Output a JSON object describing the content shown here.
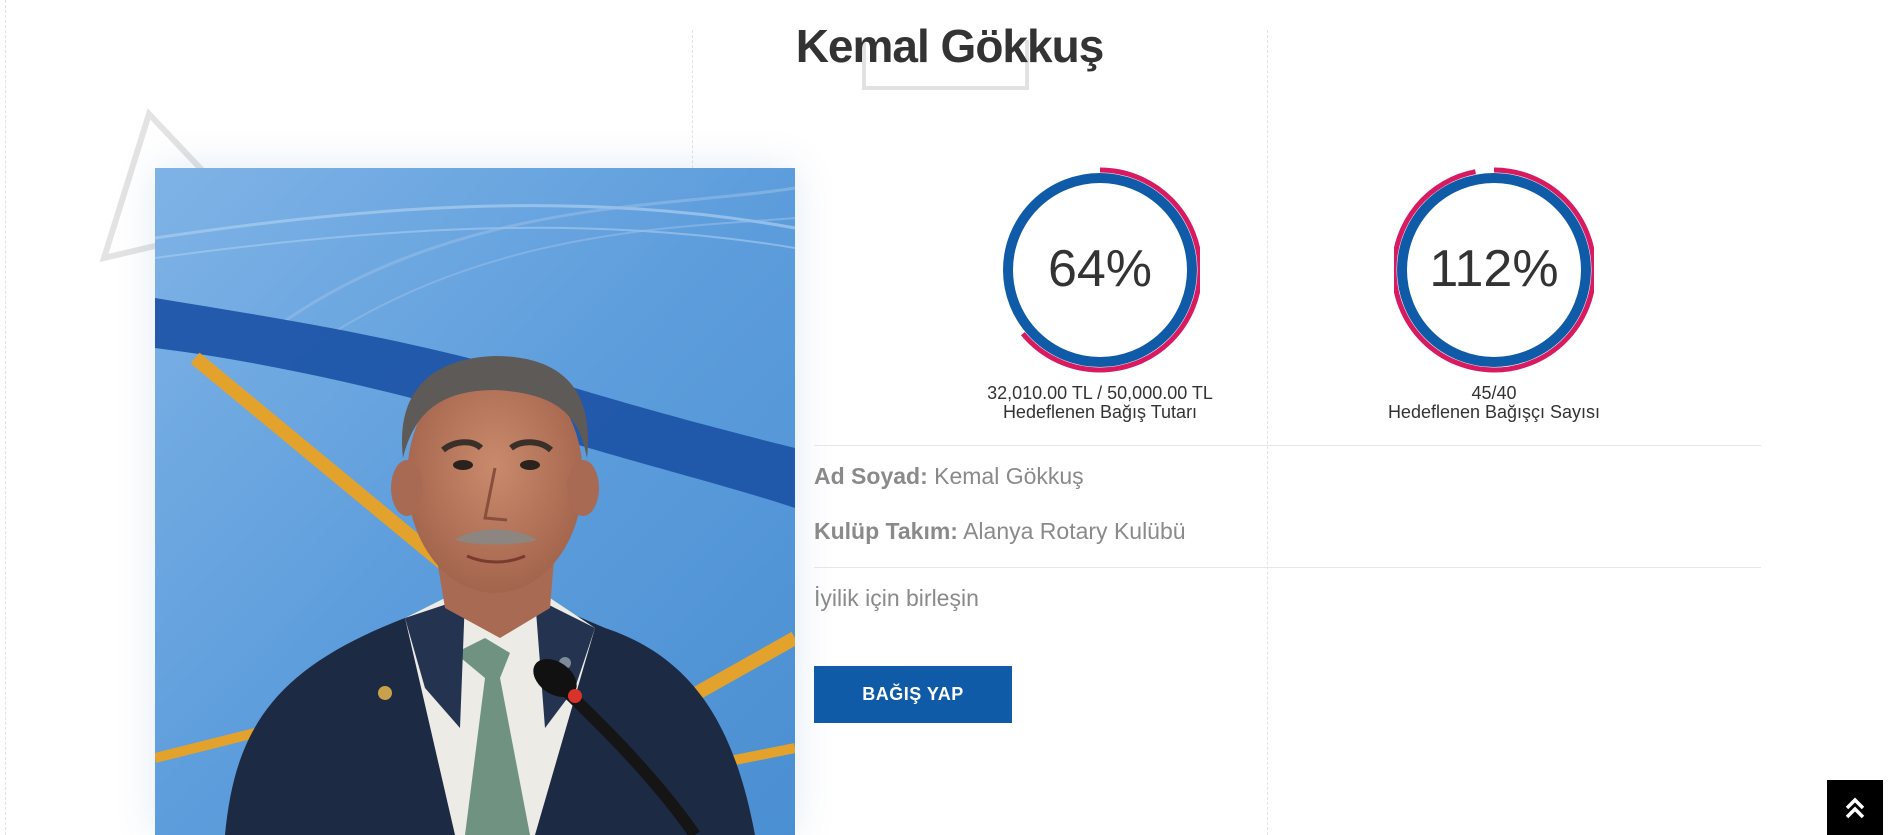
{
  "page": {
    "title": "Kemal Gökkuş"
  },
  "colors": {
    "ring_blue": "#0f5ba7",
    "ring_pink": "#d81b60",
    "button_blue": "#0f5ba7",
    "text_dark": "#333333",
    "text_muted": "#8a8a8a"
  },
  "stats": [
    {
      "percent_label": "64%",
      "percent_value": 64,
      "amount": "32,010.00 TL / 50,000.00 TL",
      "caption": "Hedeflenen Bağış Tutarı"
    },
    {
      "percent_label": "112%",
      "percent_value": 112,
      "amount": "45/40",
      "caption": "Hedeflenen Bağışçı Sayısı"
    }
  ],
  "info": {
    "name_label": "Ad Soyad:",
    "name_value": "Kemal Gökkuş",
    "club_label": "Kulüp Takım:",
    "club_value": "Alanya Rotary Kulübü"
  },
  "motto": "İyilik için birleşin",
  "donate_button": "BAĞIŞ YAP",
  "scroll_top_icon": "double-chevron-up-icon"
}
